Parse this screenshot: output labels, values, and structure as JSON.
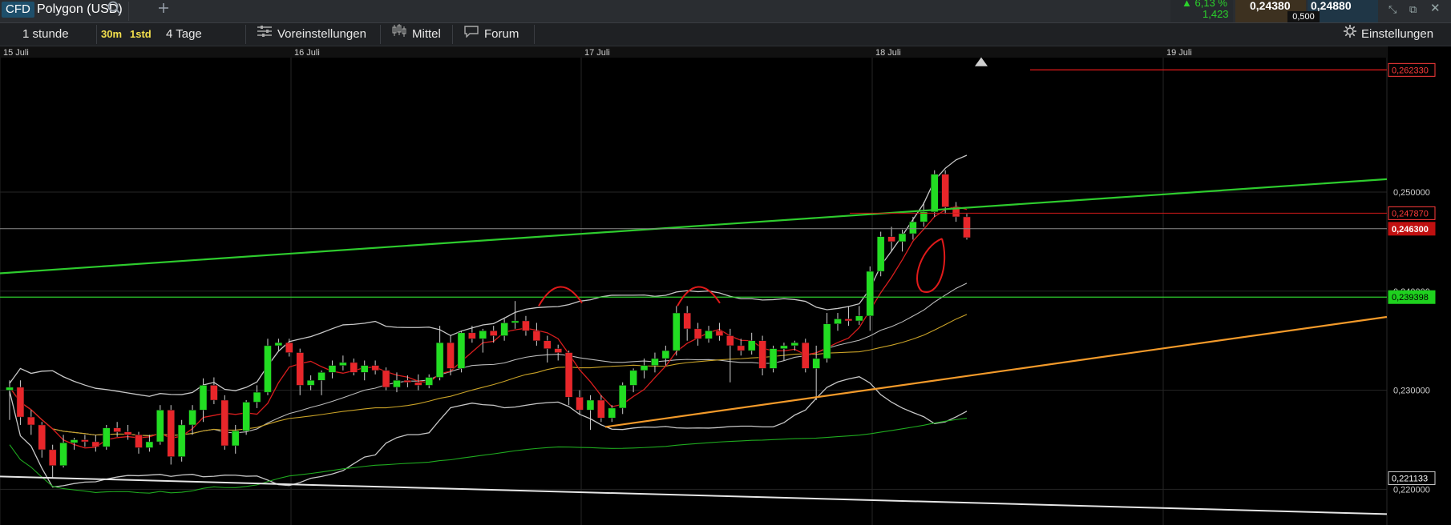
{
  "header": {
    "badge": "CFD",
    "symbol": "Polygon (USD)",
    "change_pct": "6,13 %",
    "change_abs": "1,423",
    "sell_price": "0,24380",
    "buy_price": "0,24880",
    "spread": "0,500"
  },
  "toolbar": {
    "interval": "1 stunde",
    "quick_1": "30m",
    "quick_2": "1std",
    "range": "4 Tage",
    "presets": "Voreinstellungen",
    "indicators": "Mittel",
    "forum": "Forum",
    "settings": "Einstellungen"
  },
  "icons": {
    "search": "search-icon",
    "add": "plus-icon",
    "presets": "sliders-icon",
    "indicators": "candles-icon",
    "forum": "chat-icon",
    "settings": "gear-icon"
  },
  "colors": {
    "bull": "#22dd22",
    "bear": "#e8262a",
    "green_line": "#2ecc2e",
    "orange_line": "#f39a2a",
    "red_marker": "#d01818",
    "bollinger": "#c8c8c8"
  },
  "chart_data": {
    "type": "candlestick",
    "x_labels": [
      "15 Juli",
      "16 Juli",
      "17 Juli",
      "18 Juli",
      "19 Juli"
    ],
    "y_ticks": [
      "0,250000",
      "0,240000",
      "0,230000",
      "0,220000"
    ],
    "y_tick_values": [
      0.25,
      0.24,
      0.23,
      0.22
    ],
    "ylim": [
      0.2164,
      0.2647
    ],
    "price_tags": [
      {
        "label": "0,262330",
        "value": 0.26233,
        "style": "red"
      },
      {
        "label": "0,247870",
        "value": 0.24787,
        "style": "red"
      },
      {
        "label": "0,246300",
        "value": 0.2463,
        "style": "red-bold"
      },
      {
        "label": "0,239398",
        "value": 0.2394,
        "style": "green"
      },
      {
        "label": "0,221133",
        "value": 0.22113,
        "style": "white"
      }
    ],
    "candles": [
      [
        0.23,
        0.231,
        0.227,
        0.2303
      ],
      [
        0.2303,
        0.231,
        0.2265,
        0.2273
      ],
      [
        0.2273,
        0.228,
        0.2255,
        0.2265
      ],
      [
        0.2265,
        0.2268,
        0.2232,
        0.224
      ],
      [
        0.224,
        0.2245,
        0.2212,
        0.2224
      ],
      [
        0.2224,
        0.2255,
        0.2222,
        0.2247
      ],
      [
        0.2247,
        0.2252,
        0.224,
        0.225
      ],
      [
        0.225,
        0.2255,
        0.2243,
        0.2248
      ],
      [
        0.2248,
        0.2255,
        0.2238,
        0.2243
      ],
      [
        0.2243,
        0.2265,
        0.224,
        0.2262
      ],
      [
        0.2262,
        0.2268,
        0.2253,
        0.2258
      ],
      [
        0.2258,
        0.2265,
        0.225,
        0.2255
      ],
      [
        0.2255,
        0.2258,
        0.2236,
        0.2242
      ],
      [
        0.2242,
        0.2255,
        0.2238,
        0.2248
      ],
      [
        0.2248,
        0.2285,
        0.2245,
        0.228
      ],
      [
        0.228,
        0.2285,
        0.2225,
        0.2233
      ],
      [
        0.2233,
        0.227,
        0.2228,
        0.2265
      ],
      [
        0.2265,
        0.2285,
        0.2255,
        0.228
      ],
      [
        0.228,
        0.2312,
        0.2268,
        0.2305
      ],
      [
        0.2305,
        0.2313,
        0.2286,
        0.229
      ],
      [
        0.229,
        0.2295,
        0.224,
        0.2244
      ],
      [
        0.2244,
        0.2265,
        0.2236,
        0.2259
      ],
      [
        0.2259,
        0.229,
        0.2255,
        0.2288
      ],
      [
        0.2288,
        0.2305,
        0.2282,
        0.2298
      ],
      [
        0.2298,
        0.2352,
        0.2295,
        0.2345
      ],
      [
        0.2345,
        0.2352,
        0.234,
        0.2348
      ],
      [
        0.2348,
        0.2352,
        0.2334,
        0.2338
      ],
      [
        0.2338,
        0.2342,
        0.2295,
        0.2305
      ],
      [
        0.2305,
        0.2315,
        0.23,
        0.231
      ],
      [
        0.231,
        0.232,
        0.2295,
        0.2318
      ],
      [
        0.2318,
        0.233,
        0.2312,
        0.2325
      ],
      [
        0.2325,
        0.2335,
        0.232,
        0.2328
      ],
      [
        0.2328,
        0.2332,
        0.2315,
        0.2318
      ],
      [
        0.2318,
        0.233,
        0.231,
        0.2325
      ],
      [
        0.2325,
        0.233,
        0.2316,
        0.232
      ],
      [
        0.232,
        0.2323,
        0.23,
        0.2303
      ],
      [
        0.2303,
        0.2318,
        0.2298,
        0.231
      ],
      [
        0.231,
        0.2315,
        0.2303,
        0.2308
      ],
      [
        0.2308,
        0.2316,
        0.23,
        0.2305
      ],
      [
        0.2305,
        0.2316,
        0.2302,
        0.2313
      ],
      [
        0.2313,
        0.2365,
        0.231,
        0.2348
      ],
      [
        0.2348,
        0.2355,
        0.2315,
        0.2322
      ],
      [
        0.2322,
        0.236,
        0.2318,
        0.2358
      ],
      [
        0.2358,
        0.2365,
        0.2348,
        0.2352
      ],
      [
        0.2352,
        0.2362,
        0.2338,
        0.236
      ],
      [
        0.236,
        0.2365,
        0.2348,
        0.2355
      ],
      [
        0.2355,
        0.2372,
        0.235,
        0.2368
      ],
      [
        0.2368,
        0.239,
        0.2362,
        0.237
      ],
      [
        0.237,
        0.2375,
        0.2355,
        0.236
      ],
      [
        0.236,
        0.2368,
        0.2345,
        0.235
      ],
      [
        0.235,
        0.2355,
        0.2328,
        0.2342
      ],
      [
        0.2342,
        0.2346,
        0.233,
        0.2338
      ],
      [
        0.2338,
        0.234,
        0.2285,
        0.2293
      ],
      [
        0.2293,
        0.23,
        0.2275,
        0.228
      ],
      [
        0.228,
        0.2295,
        0.226,
        0.229
      ],
      [
        0.229,
        0.2295,
        0.2268,
        0.2272
      ],
      [
        0.2272,
        0.2285,
        0.2268,
        0.2282
      ],
      [
        0.2282,
        0.2308,
        0.2276,
        0.2305
      ],
      [
        0.2305,
        0.2322,
        0.2298,
        0.232
      ],
      [
        0.232,
        0.2332,
        0.2312,
        0.2325
      ],
      [
        0.2325,
        0.2338,
        0.2318,
        0.2332
      ],
      [
        0.2332,
        0.2345,
        0.2325,
        0.234
      ],
      [
        0.234,
        0.2385,
        0.2335,
        0.2378
      ],
      [
        0.2378,
        0.2385,
        0.235,
        0.2362
      ],
      [
        0.2362,
        0.2368,
        0.2345,
        0.2352
      ],
      [
        0.2352,
        0.2365,
        0.2348,
        0.236
      ],
      [
        0.236,
        0.2368,
        0.235,
        0.2355
      ],
      [
        0.2355,
        0.2362,
        0.2308,
        0.2345
      ],
      [
        0.2345,
        0.2352,
        0.2335,
        0.234
      ],
      [
        0.234,
        0.2358,
        0.2336,
        0.235
      ],
      [
        0.235,
        0.2355,
        0.2315,
        0.2322
      ],
      [
        0.2322,
        0.2345,
        0.2318,
        0.2342
      ],
      [
        0.2342,
        0.2348,
        0.233,
        0.2345
      ],
      [
        0.2345,
        0.235,
        0.234,
        0.2348
      ],
      [
        0.2348,
        0.2352,
        0.2318,
        0.2322
      ],
      [
        0.2322,
        0.2345,
        0.229,
        0.2332
      ],
      [
        0.2332,
        0.2378,
        0.2328,
        0.2367
      ],
      [
        0.2367,
        0.2378,
        0.236,
        0.2372
      ],
      [
        0.2372,
        0.2385,
        0.2365,
        0.237
      ],
      [
        0.237,
        0.2385,
        0.2366,
        0.2375
      ],
      [
        0.2375,
        0.2425,
        0.236,
        0.242
      ],
      [
        0.242,
        0.246,
        0.2415,
        0.2455
      ],
      [
        0.2455,
        0.2465,
        0.244,
        0.245
      ],
      [
        0.245,
        0.2462,
        0.244,
        0.2458
      ],
      [
        0.2458,
        0.2475,
        0.2452,
        0.247
      ],
      [
        0.247,
        0.249,
        0.2465,
        0.248
      ],
      [
        0.248,
        0.2522,
        0.2475,
        0.2518
      ],
      [
        0.2518,
        0.2522,
        0.2478,
        0.2485
      ],
      [
        0.2485,
        0.249,
        0.247,
        0.2475
      ],
      [
        0.2475,
        0.2478,
        0.2452,
        0.2454
      ]
    ]
  }
}
